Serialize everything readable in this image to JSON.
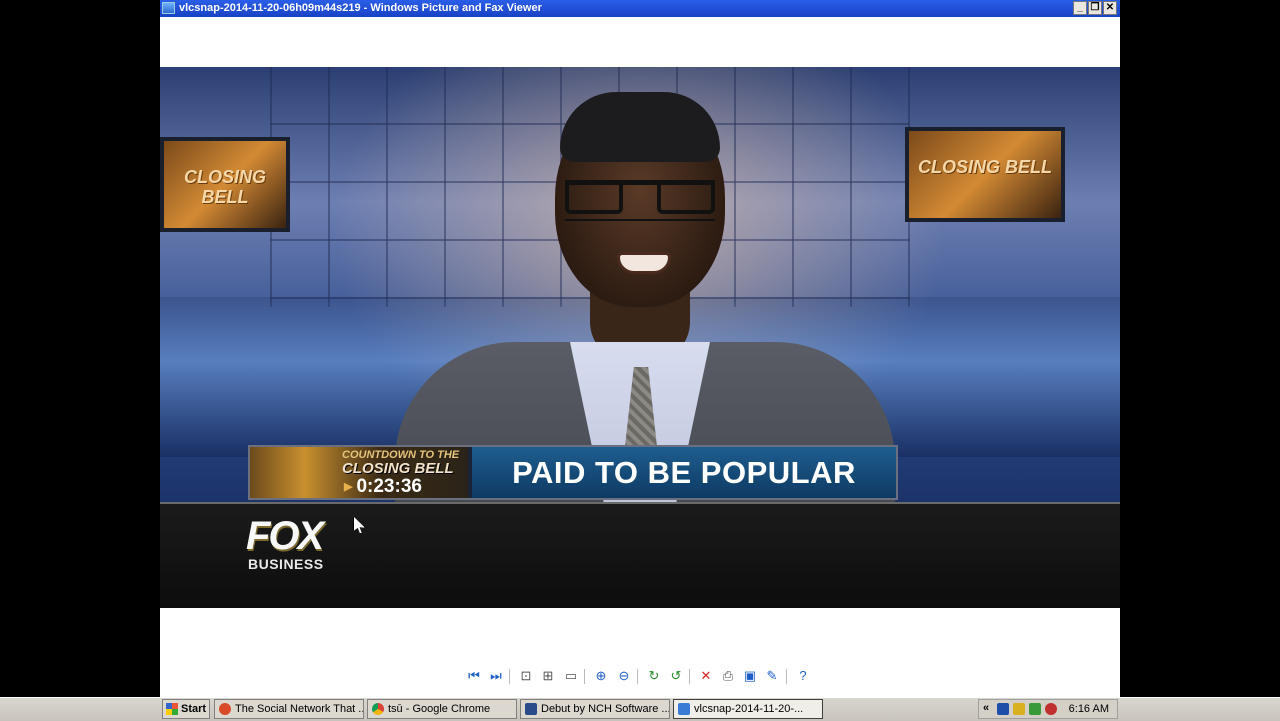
{
  "window": {
    "title": "vlcsnap-2014-11-20-06h09m44s219 - Windows Picture and Fax Viewer",
    "buttons": [
      "_",
      "❐",
      "✕"
    ]
  },
  "image": {
    "monitor_left": "CLOSING BELL",
    "monitor_right": "CLOSING BELL",
    "lower_third": {
      "countdown_label": "COUNTDOWN TO THE",
      "show_name": "CLOSING BELL",
      "timer": "0:23:36",
      "headline": "PAID TO BE POPULAR"
    },
    "logo": {
      "word": "FOX",
      "sub": "BUSINESS"
    }
  },
  "toolbar": {
    "icons": [
      "previous-icon",
      "next-icon",
      "best-fit-icon",
      "actual-size-icon",
      "slideshow-icon",
      "zoom-in-icon",
      "zoom-out-icon",
      "rotate-cw-icon",
      "rotate-ccw-icon",
      "delete-icon",
      "print-icon",
      "save-icon",
      "edit-icon",
      "help-icon"
    ]
  },
  "taskbar": {
    "start": "Start",
    "tasks": [
      "The Social Network That ...",
      "tsū - Google Chrome",
      "Debut by NCH Software ...",
      "vlcsnap-2014-11-20-..."
    ],
    "tray_chevron": "«",
    "clock": "6:16 AM"
  }
}
